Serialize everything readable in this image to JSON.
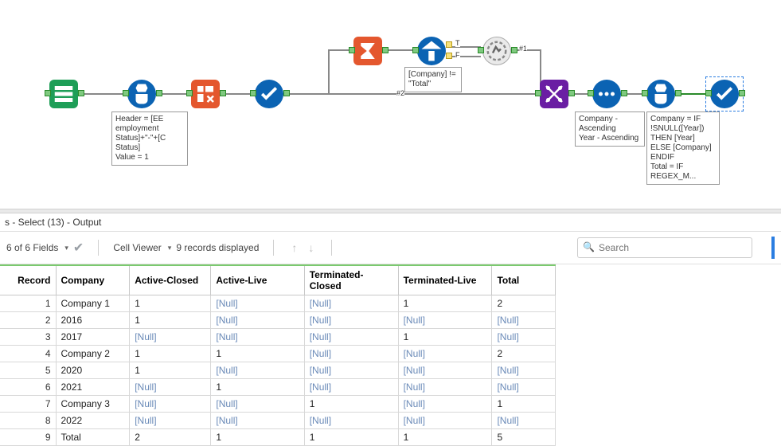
{
  "canvas": {
    "annotations": {
      "formula1": "Header = [EE employment Status]+\"-\"+[C Status]\nValue = 1",
      "filter": "[Company] != \"Total\"",
      "sort": "Company - Ascending\nYear - Ascending",
      "formula2": "Company = IF !SNULL([Year]) THEN [Year] ELSE [Company] ENDIF\nTotal = IF REGEX_M...",
      "hash1": "#1",
      "hash2": "#2",
      "port_t": "T",
      "port_f": "F"
    }
  },
  "panel": {
    "title": "s - Select (13) - Output",
    "fields_label": "6 of 6 Fields",
    "cellviewer_label": "Cell Viewer",
    "records_label": "9 records displayed",
    "search_placeholder": "Search"
  },
  "table": {
    "headers": {
      "record": "Record",
      "company": "Company",
      "active_closed": "Active-Closed",
      "active_live": "Active-Live",
      "terminated_closed": "Terminated-Closed",
      "terminated_live": "Terminated-Live",
      "total": "Total"
    },
    "rows": [
      {
        "n": "1",
        "company": "Company 1",
        "ac": "1",
        "al": "[Null]",
        "tc": "[Null]",
        "tl": "1",
        "tot": "2"
      },
      {
        "n": "2",
        "company": "2016",
        "ac": "1",
        "al": "[Null]",
        "tc": "[Null]",
        "tl": "[Null]",
        "tot": "[Null]"
      },
      {
        "n": "3",
        "company": "2017",
        "ac": "[Null]",
        "al": "[Null]",
        "tc": "[Null]",
        "tl": "1",
        "tot": "[Null]"
      },
      {
        "n": "4",
        "company": "Company 2",
        "ac": "1",
        "al": "1",
        "tc": "[Null]",
        "tl": "[Null]",
        "tot": "2"
      },
      {
        "n": "5",
        "company": "2020",
        "ac": "1",
        "al": "[Null]",
        "tc": "[Null]",
        "tl": "[Null]",
        "tot": "[Null]"
      },
      {
        "n": "6",
        "company": "2021",
        "ac": "[Null]",
        "al": "1",
        "tc": "[Null]",
        "tl": "[Null]",
        "tot": "[Null]"
      },
      {
        "n": "7",
        "company": "Company 3",
        "ac": "[Null]",
        "al": "[Null]",
        "tc": "1",
        "tl": "[Null]",
        "tot": "1"
      },
      {
        "n": "8",
        "company": "2022",
        "ac": "[Null]",
        "al": "[Null]",
        "tc": "[Null]",
        "tl": "[Null]",
        "tot": "[Null]"
      },
      {
        "n": "9",
        "company": "Total",
        "ac": "2",
        "al": "1",
        "tc": "1",
        "tl": "1",
        "tot": "5"
      }
    ]
  }
}
